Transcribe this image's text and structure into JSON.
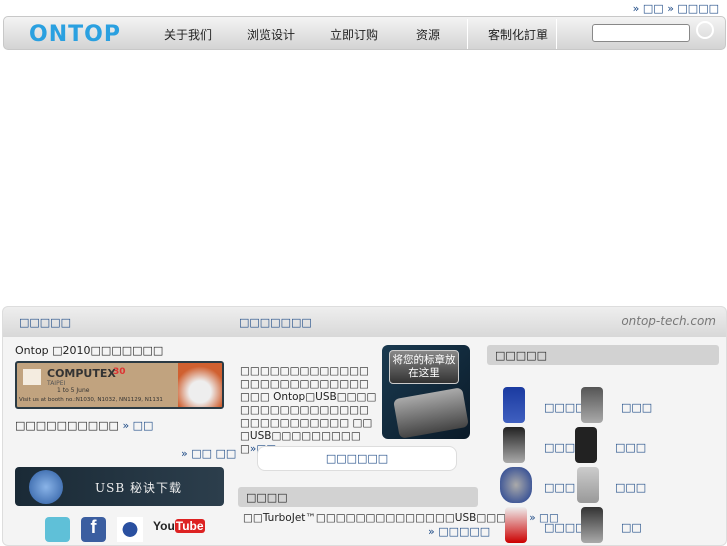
{
  "top_links": [
    "» □□",
    "» □□□□"
  ],
  "logo": {
    "text1": "ONT",
    "text2": "OP"
  },
  "nav": [
    "关于我们",
    "浏览设计",
    "立即订购",
    "资源",
    "客制化訂單"
  ],
  "search": {
    "placeholder": ""
  },
  "sections": {
    "left_title": "□□□□□",
    "mid_title": "□□□□□□□",
    "site": "ontop-tech.com"
  },
  "left": {
    "news": "Ontop □2010□□□□□□□",
    "banner": {
      "title": "COMPUTEX",
      "num": "30",
      "sub": "TAIPEI",
      "date": "1 to 5 June",
      "booth": "Visit us at booth no.:N1030, N1032, NN1129, N1131"
    },
    "item": "□□□□□□□□□□",
    "more": "» □□",
    "more_news": "» □□ □□",
    "download": "USB 秘诀下载",
    "social": [
      "Twitter",
      "Facebook",
      "MySpace",
      "YouTube"
    ]
  },
  "mid": {
    "intro": "□□□□□□□□□□□□□□□□□□□□□□□□□□□□□ Ontop□USB□□□□□□□□□□□□□□□□□□□□□□□□□□□□ □□□USB□□□□□□□□□□",
    "intro_more": "»□□",
    "badge": "将您的标章放在这里",
    "button": "□□□□□□",
    "panel_title": "□□□□",
    "panel_text": "□□TurboJet™□□□□□□□□□□□□□□USB□□□□□",
    "panel_more": "» □□",
    "panel_more2": "» □□□□□"
  },
  "right": {
    "title": "□□□□□",
    "products": [
      "□□□□",
      "□□□",
      "□□□",
      "□□□",
      "□□□",
      "□□□",
      "□□□□",
      "□□"
    ]
  }
}
